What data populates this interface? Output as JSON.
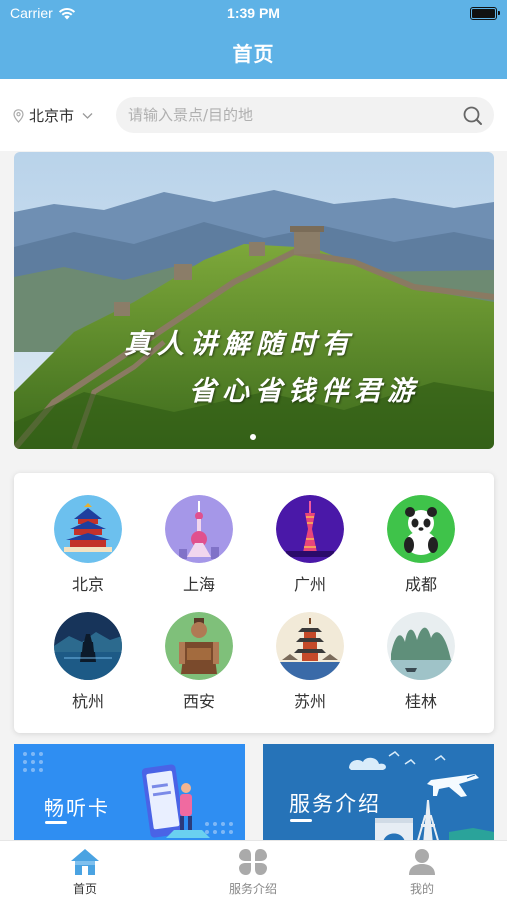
{
  "status_bar": {
    "carrier": "Carrier",
    "time": "1:39 PM"
  },
  "header": {
    "title": "首页"
  },
  "location": {
    "city": "北京市"
  },
  "search": {
    "placeholder": "请输入景点/目的地",
    "value": ""
  },
  "banner": {
    "line1": "真人讲解随时有",
    "line2": "省心省钱伴君游",
    "page_index": 1,
    "page_count": 1
  },
  "cities": [
    {
      "name": "北京",
      "icon": "temple-of-heaven-icon"
    },
    {
      "name": "上海",
      "icon": "oriental-pearl-tower-icon"
    },
    {
      "name": "广州",
      "icon": "canton-tower-icon"
    },
    {
      "name": "成都",
      "icon": "panda-icon"
    },
    {
      "name": "杭州",
      "icon": "west-lake-pagoda-icon"
    },
    {
      "name": "西安",
      "icon": "terracotta-warrior-icon"
    },
    {
      "name": "苏州",
      "icon": "suzhou-pagoda-icon"
    },
    {
      "name": "桂林",
      "icon": "karst-mountains-icon"
    }
  ],
  "promos": [
    {
      "title": "畅听卡",
      "color": "#2f8ef2"
    },
    {
      "title": "服务介绍",
      "color": "#2673b8"
    }
  ],
  "tabbar": {
    "items": [
      {
        "label": "首页",
        "icon": "home-icon",
        "active": true
      },
      {
        "label": "服务介绍",
        "icon": "grid-icon",
        "active": false
      },
      {
        "label": "我的",
        "icon": "person-icon",
        "active": false
      }
    ]
  },
  "colors": {
    "header": "#5eb2e6",
    "active_tab": "#4aa3e2",
    "inactive_tab": "#aaaaaa"
  }
}
